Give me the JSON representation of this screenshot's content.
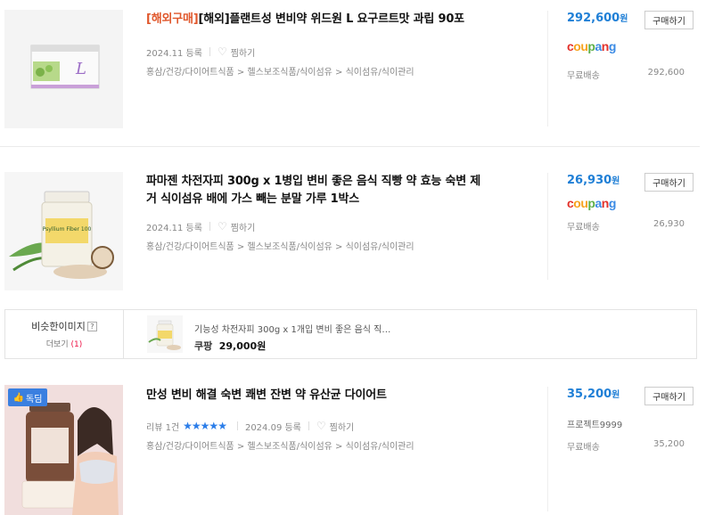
{
  "products": [
    {
      "tag": "[해외구매]",
      "title": "[해외]플랜트성 변비약 위드원 L 요구르트맛 과립 90포",
      "date": "2024.11 등록",
      "wish": "찜하기",
      "category": "홍삼/건강/다이어트식품 > 헬스보조식품/식이섬유 > 식이섬유/식이관리",
      "price": "292,600",
      "won": "원",
      "buy": "구매하기",
      "store": "coupang",
      "shipping": "무료배송",
      "ship_price": "292,600"
    },
    {
      "title_line1": "파마젠 차전자피 300g x 1병입 변비 좋은 음식 직빵 약 효능 숙변 제",
      "title_line2": "거 식이섬유 배에 가스 빼는 분말 가루 1박스",
      "date": "2024.11 등록",
      "wish": "찜하기",
      "category": "홍삼/건강/다이어트식품 > 헬스보조식품/식이섬유 > 식이섬유/식이관리",
      "price": "26,930",
      "won": "원",
      "buy": "구매하기",
      "store": "coupang",
      "shipping": "무료배송",
      "ship_price": "26,930",
      "image_label": "Psyllium Fiber 100"
    },
    {
      "badge": "독딤",
      "title": "만성 변비 해결 숙변 쾌변 잔변 약 유산균 다이어트",
      "review": "리뷰 1건",
      "stars": "★★★★★",
      "date": "2024.09 등록",
      "wish": "찜하기",
      "category": "홍삼/건강/다이어트식품 > 헬스보조식품/식이섬유 > 식이섬유/식이관리",
      "price": "35,200",
      "won": "원",
      "buy": "구매하기",
      "store": "프로젝트9999",
      "shipping": "무료배송",
      "ship_price": "35,200"
    }
  ],
  "similar": {
    "title": "비슷한이미지",
    "help": "?",
    "more": "더보기",
    "count": "(1)",
    "name": "기능성 차전자피 300g x 1개입 변비 좋은 음식 직…",
    "shop": "쿠팡",
    "price": "29,000원"
  },
  "colors": {
    "price": "#1f7fd6",
    "tag": "#e0572b",
    "coupang_c": "#e3322b",
    "coupang_o": "#f7a21b",
    "coupang_u": "#5fb049",
    "coupang_p": "#3b8be5",
    "badge": "#3a7fe0"
  }
}
